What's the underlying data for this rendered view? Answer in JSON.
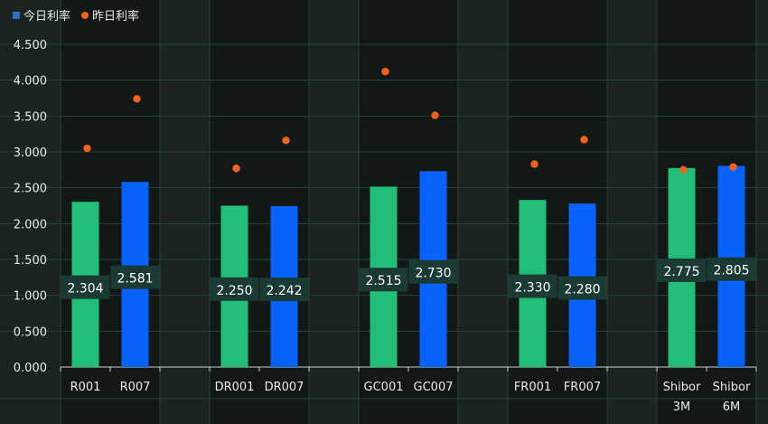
{
  "chart_data": {
    "type": "bar",
    "categories": [
      "R001",
      "R007",
      "DR001",
      "DR007",
      "GC001",
      "GC007",
      "FR001",
      "FR007",
      "Shibor 3M",
      "Shibor 6M"
    ],
    "category_lines": [
      [
        "R001"
      ],
      [
        "R007"
      ],
      [
        "DR001"
      ],
      [
        "DR007"
      ],
      [
        "GC001"
      ],
      [
        "GC007"
      ],
      [
        "FR001"
      ],
      [
        "FR007"
      ],
      [
        "Shibor",
        "3M"
      ],
      [
        "Shibor",
        "6M"
      ]
    ],
    "series": [
      {
        "name": "今日利率",
        "type": "bar",
        "values": [
          2.304,
          2.581,
          2.25,
          2.242,
          2.515,
          2.73,
          2.33,
          2.28,
          2.775,
          2.805
        ]
      },
      {
        "name": "昨日利率",
        "type": "scatter",
        "values": [
          3.05,
          3.74,
          2.77,
          3.16,
          4.12,
          3.51,
          2.83,
          3.17,
          2.75,
          2.79
        ]
      }
    ],
    "bar_labels": [
      "2.304",
      "2.581",
      "2.250",
      "2.242",
      "2.515",
      "2.730",
      "2.330",
      "2.280",
      "2.775",
      "2.805"
    ],
    "ylim": [
      0,
      4.5
    ],
    "yticks": [
      "0.000",
      "0.500",
      "1.000",
      "1.500",
      "2.000",
      "2.500",
      "3.000",
      "3.500",
      "4.000",
      "4.500"
    ],
    "grid": true,
    "legend_position": "top-left",
    "colors": {
      "bar_green": "#21be78",
      "bar_blue": "#0862fc",
      "dot": "#f2611d",
      "legend_square": "#2f6ec0",
      "label_bg": "#1a3a33",
      "grid": "#26413a",
      "band_light": "#1a2321",
      "band_dark": "#121816",
      "axis_text": "#e6ece9"
    }
  }
}
